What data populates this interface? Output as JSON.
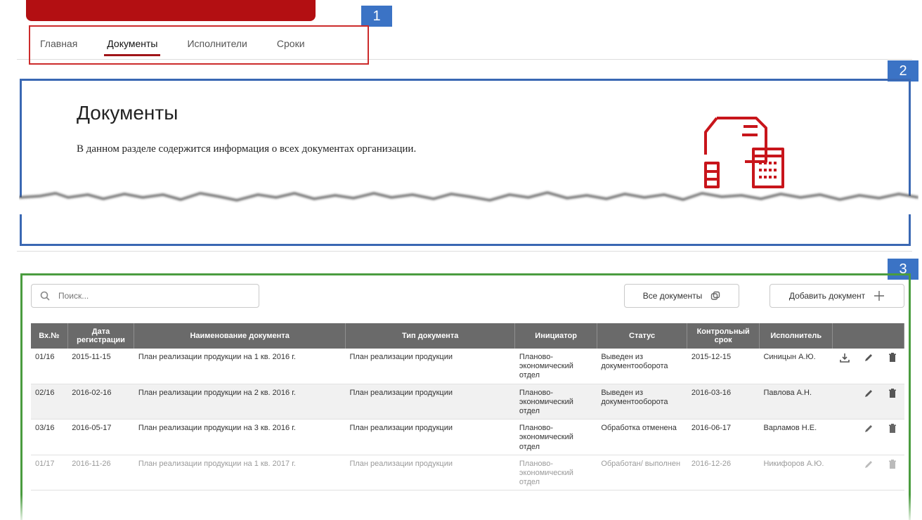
{
  "callouts": [
    "1",
    "2",
    "3"
  ],
  "nav": {
    "tabs": [
      "Главная",
      "Документы",
      "Исполнители",
      "Сроки"
    ],
    "active": "Документы"
  },
  "hero": {
    "title": "Документы",
    "description": "В данном разделе содержится информация о всех документах организации."
  },
  "toolbar": {
    "search_placeholder": "Поиск...",
    "all_docs_label": "Все документы",
    "add_doc_label": "Добавить документ"
  },
  "table": {
    "columns": [
      "Вх.№",
      "Дата регистрации",
      "Наименование документа",
      "Тип документа",
      "Инициатор",
      "Статус",
      "Контрольный срок",
      "Исполнитель"
    ],
    "rows": [
      [
        "01/16",
        "2015-11-15",
        "План реализации продукции на 1 кв. 2016 г.",
        "План реализации продукции",
        "Планово-экономический отдел",
        "Выведен из документооборота",
        "2015-12-15",
        "Синицын А.Ю."
      ],
      [
        "02/16",
        "2016-02-16",
        "План реализации продукции на 2 кв. 2016 г.",
        "План реализации продукции",
        "Планово-экономический отдел",
        "Выведен из документооборота",
        "2016-03-16",
        "Павлова А.Н."
      ],
      [
        "03/16",
        "2016-05-17",
        "План реализации продукции на 3 кв. 2016 г.",
        "План реализации продукции",
        "Планово-экономический отдел",
        "Обработка отменена",
        "2016-06-17",
        "Варламов Н.Е."
      ],
      [
        "01/17",
        "2016-11-26",
        "План реализации продукции на 1 кв. 2017 г.",
        "План реализации продукции",
        "Планово-экономический отдел",
        "Обработан/ выполнен",
        "2016-12-26",
        "Никифоров А.Ю."
      ]
    ]
  },
  "colors": {
    "brand_red": "#b30f12",
    "callout_blue": "#3b73c5",
    "hero_border": "#3a68b3",
    "table_border": "#4a9c3f",
    "header_gray": "#6a6a6a"
  },
  "icons": [
    "search-icon",
    "copy-icon",
    "plus-icon",
    "download-icon",
    "edit-icon",
    "trash-icon",
    "documents-illustration-icon"
  ]
}
